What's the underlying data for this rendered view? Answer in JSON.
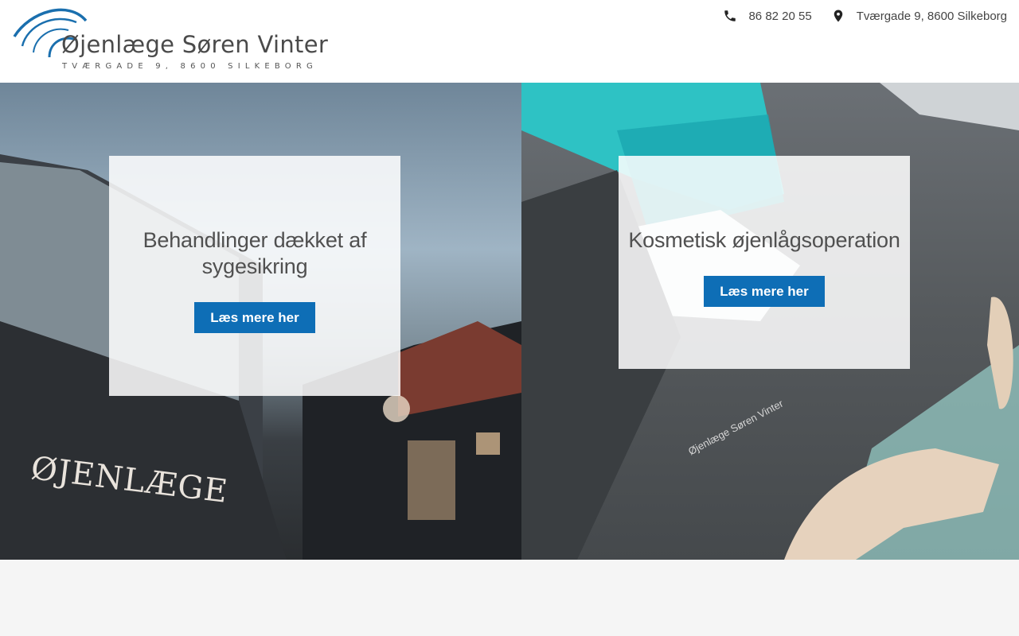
{
  "header": {
    "logo": {
      "title": "Øjenlæge Søren Vinter",
      "subtitle": "TVÆRGADE 9, 8600 SILKEBORG"
    },
    "contact": {
      "phone": "86 82 20 55",
      "address": "Tværgade 9, 8600 Silkeborg",
      "phone_icon": "phone-icon",
      "address_icon": "map-pin-icon"
    }
  },
  "hero": {
    "left": {
      "title": "Behandlinger dækket af sygesikring",
      "button_label": "Læs mere her",
      "sign_text": "ØJENLÆGE"
    },
    "right": {
      "title": "Kosmetisk øjenlågsoperation",
      "button_label": "Læs mere her",
      "uniform_text": "Øjenlæge Søren Vinter"
    }
  },
  "colors": {
    "brand_blue": "#0e6eb6",
    "logo_blue": "#1a6fae",
    "text_gray": "#505050"
  }
}
